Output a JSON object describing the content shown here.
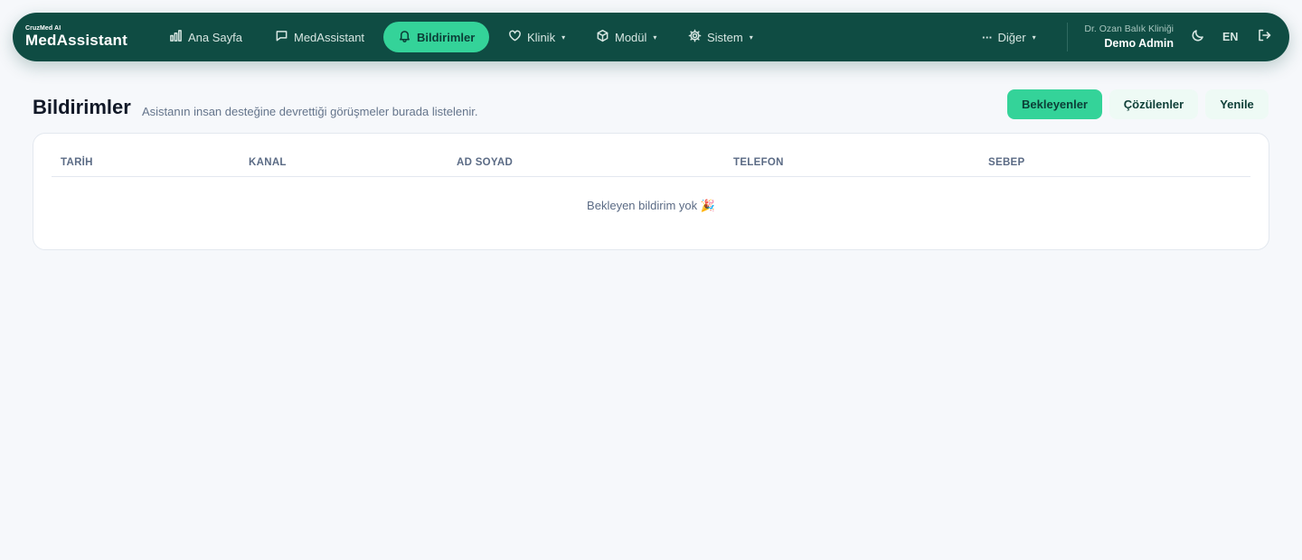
{
  "brand": {
    "small": "CruzMed AI",
    "main": "MedAssistant"
  },
  "nav": {
    "home": "Ana Sayfa",
    "assistant": "MedAssistant",
    "notifications": "Bildirimler",
    "clinic": "Klinik",
    "module": "Modül",
    "system": "Sistem",
    "more": "Diğer",
    "caret": "▾"
  },
  "user": {
    "clinic": "Dr. Ozan Balık Kliniği",
    "name": "Demo Admin",
    "lang": "EN"
  },
  "page": {
    "title": "Bildirimler",
    "subtitle": "Asistanın insan desteğine devrettiği görüşmeler burada listelenir."
  },
  "filters": {
    "pending": "Bekleyenler",
    "resolved": "Çözülenler",
    "refresh": "Yenile"
  },
  "table": {
    "columns": [
      "TARİH",
      "KANAL",
      "AD SOYAD",
      "TELEFON",
      "SEBEP"
    ],
    "empty": "Bekleyen bildirim yok 🎉"
  },
  "icons": {
    "home": "bar-chart-icon",
    "assistant": "chat-bubble-icon",
    "notifications": "bell-icon",
    "clinic": "heart-icon",
    "module": "cube-icon",
    "system": "gear-icon",
    "more": "dots-icon",
    "theme": "moon-icon",
    "logout": "logout-icon"
  },
  "colors": {
    "nav_bg": "#0f4c43",
    "accent": "#34d399",
    "page_bg": "#f6f8fb"
  }
}
